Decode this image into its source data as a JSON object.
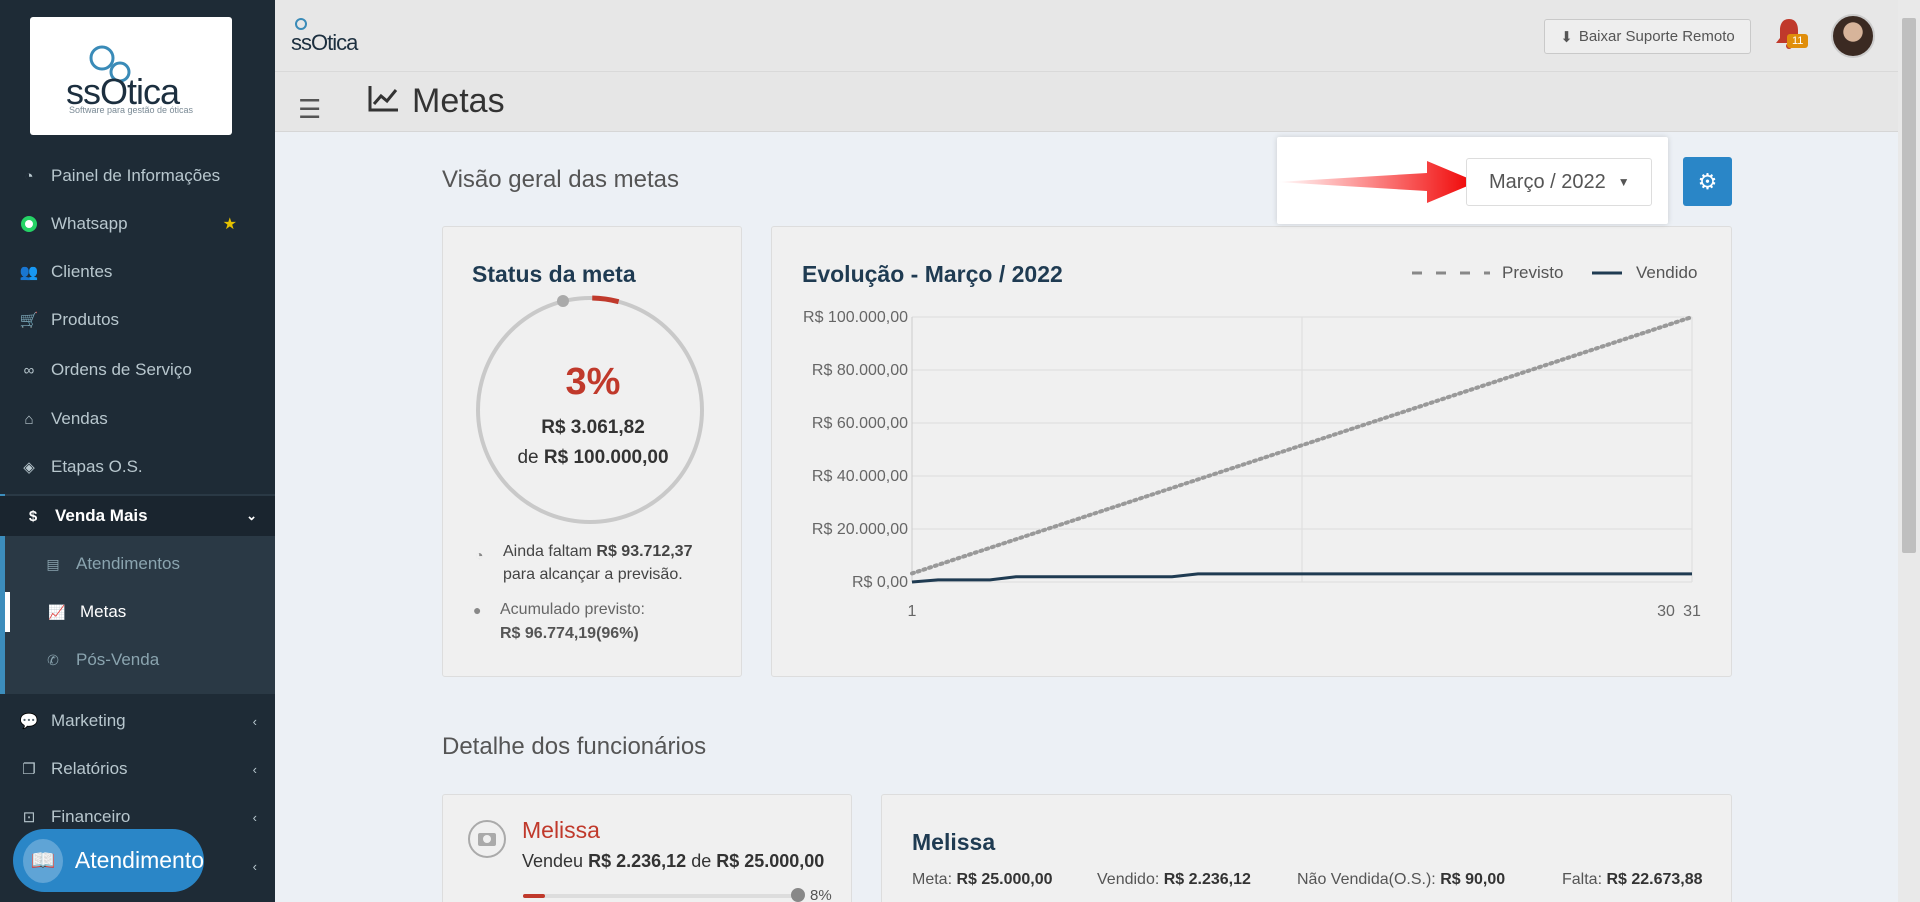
{
  "sidebar": {
    "logo_text": "ssOtica",
    "logo_subtitle": "Software para gestão de óticas",
    "items": [
      {
        "label": "Painel de Informações",
        "icon": "dashboard-icon"
      },
      {
        "label": "Whatsapp",
        "icon": "whatsapp-icon",
        "starred": true
      },
      {
        "label": "Clientes",
        "icon": "users-icon"
      },
      {
        "label": "Produtos",
        "icon": "cart-icon"
      },
      {
        "label": "Ordens de Serviço",
        "icon": "glasses-icon"
      },
      {
        "label": "Vendas",
        "icon": "basket-icon"
      },
      {
        "label": "Etapas O.S.",
        "icon": "tags-icon"
      },
      {
        "label": "Venda Mais",
        "icon": "dollar-icon",
        "expanded": true
      },
      {
        "label": "Marketing",
        "icon": "comments-icon"
      },
      {
        "label": "Relatórios",
        "icon": "copy-icon"
      },
      {
        "label": "Financeiro",
        "icon": "money-icon"
      }
    ],
    "subitems": [
      {
        "label": "Atendimentos",
        "icon": "clipboard-icon"
      },
      {
        "label": "Metas",
        "icon": "chart-line-icon",
        "active": true
      },
      {
        "label": "Pós-Venda",
        "icon": "phone-icon"
      }
    ],
    "chat_button": "Atendimento"
  },
  "header": {
    "logo_text": "ssOtica",
    "remote_support": "Baixar Suporte Remoto",
    "notifications_count": "11",
    "page_title": "Metas"
  },
  "overview": {
    "title": "Visão geral das metas",
    "month_selector": "Março / 2022",
    "status_card": {
      "title": "Status da meta",
      "percent": "3%",
      "percent_value": 3,
      "sold": "R$ 3.061,82",
      "of_label": "de",
      "goal": "R$ 100.000,00",
      "remaining_prefix": "Ainda faltam",
      "remaining_value": "R$ 93.712,37",
      "remaining_suffix": "para alcançar a previsão.",
      "accumulated_label": "Acumulado previsto:",
      "accumulated_value": "R$ 96.774,19(96%)"
    }
  },
  "chart_data": {
    "type": "line",
    "title": "Evolução - Março / 2022",
    "series": [
      {
        "name": "Previsto",
        "style": "dotted",
        "color": "#999999",
        "x": [
          1,
          31
        ],
        "y": [
          3226,
          100000
        ]
      },
      {
        "name": "Vendido",
        "style": "solid",
        "color": "#1f3b52",
        "x": [
          1,
          2,
          3,
          4,
          5,
          6,
          7,
          8,
          9,
          10,
          11,
          12,
          31
        ],
        "y": [
          0,
          800,
          800,
          800,
          2000,
          2000,
          2000,
          2000,
          2000,
          2000,
          2000,
          3062,
          3062
        ]
      }
    ],
    "yticks": [
      "R$ 100.000,00",
      "R$ 80.000,00",
      "R$ 60.000,00",
      "R$ 40.000,00",
      "R$ 20.000,00",
      "R$ 0,00"
    ],
    "xticks": [
      "1",
      "30",
      "31"
    ],
    "ylim": [
      0,
      100000
    ],
    "xlim": [
      1,
      31
    ],
    "legend_position": "top-right"
  },
  "employees": {
    "title": "Detalhe dos funcionários",
    "card_left": {
      "name": "Melissa",
      "sold_prefix": "Vendeu",
      "sold_value": "R$ 2.236,12",
      "of_label": "de",
      "goal_value": "R$ 25.000,00",
      "progress_label": "8%",
      "progress_value": 0.08
    },
    "card_right": {
      "name": "Melissa",
      "meta_label": "Meta:",
      "meta_value": "R$ 25.000,00",
      "sold_label": "Vendido:",
      "sold_value": "R$ 2.236,12",
      "unsold_label": "Não Vendida(O.S.):",
      "unsold_value": "R$ 90,00",
      "missing_label": "Falta:",
      "missing_value": "R$ 22.673,88"
    }
  },
  "colors": {
    "sidebar": "#1e2b36",
    "accent": "#2a86c7",
    "danger": "#c0392b",
    "navy": "#1f3b52"
  }
}
